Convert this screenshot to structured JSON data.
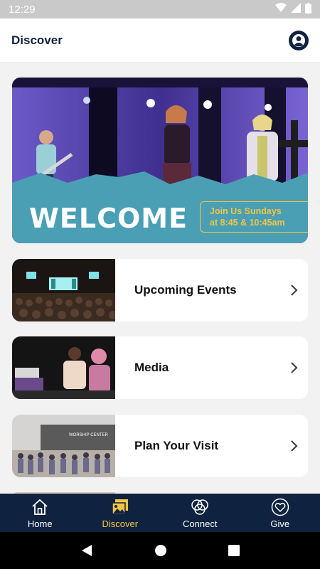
{
  "status_bar": {
    "time": "12:29",
    "icons": [
      "wifi-icon",
      "signal-icon",
      "battery-icon"
    ]
  },
  "header": {
    "title": "Discover",
    "profile_icon": "profile-icon"
  },
  "hero": {
    "welcome": "WELCOME",
    "times_line1": "Join Us Sundays",
    "times_line2": "at 8:45 & 10:45am"
  },
  "cards": [
    {
      "label": "Upcoming Events"
    },
    {
      "label": "Media"
    },
    {
      "label": "Plan Your Visit"
    }
  ],
  "card_thumb_texts": {
    "plan_visit_sign": "WORSHIP CENTER"
  },
  "bottom_nav": [
    {
      "label": "Home",
      "icon": "home-icon"
    },
    {
      "label": "Discover",
      "icon": "images-icon",
      "active": true
    },
    {
      "label": "Connect",
      "icon": "connect-icon"
    },
    {
      "label": "Give",
      "icon": "heart-icon"
    }
  ],
  "colors": {
    "navy": "#0f2340",
    "accent": "#f4c542",
    "hero_teal": "#4a9fb5"
  }
}
